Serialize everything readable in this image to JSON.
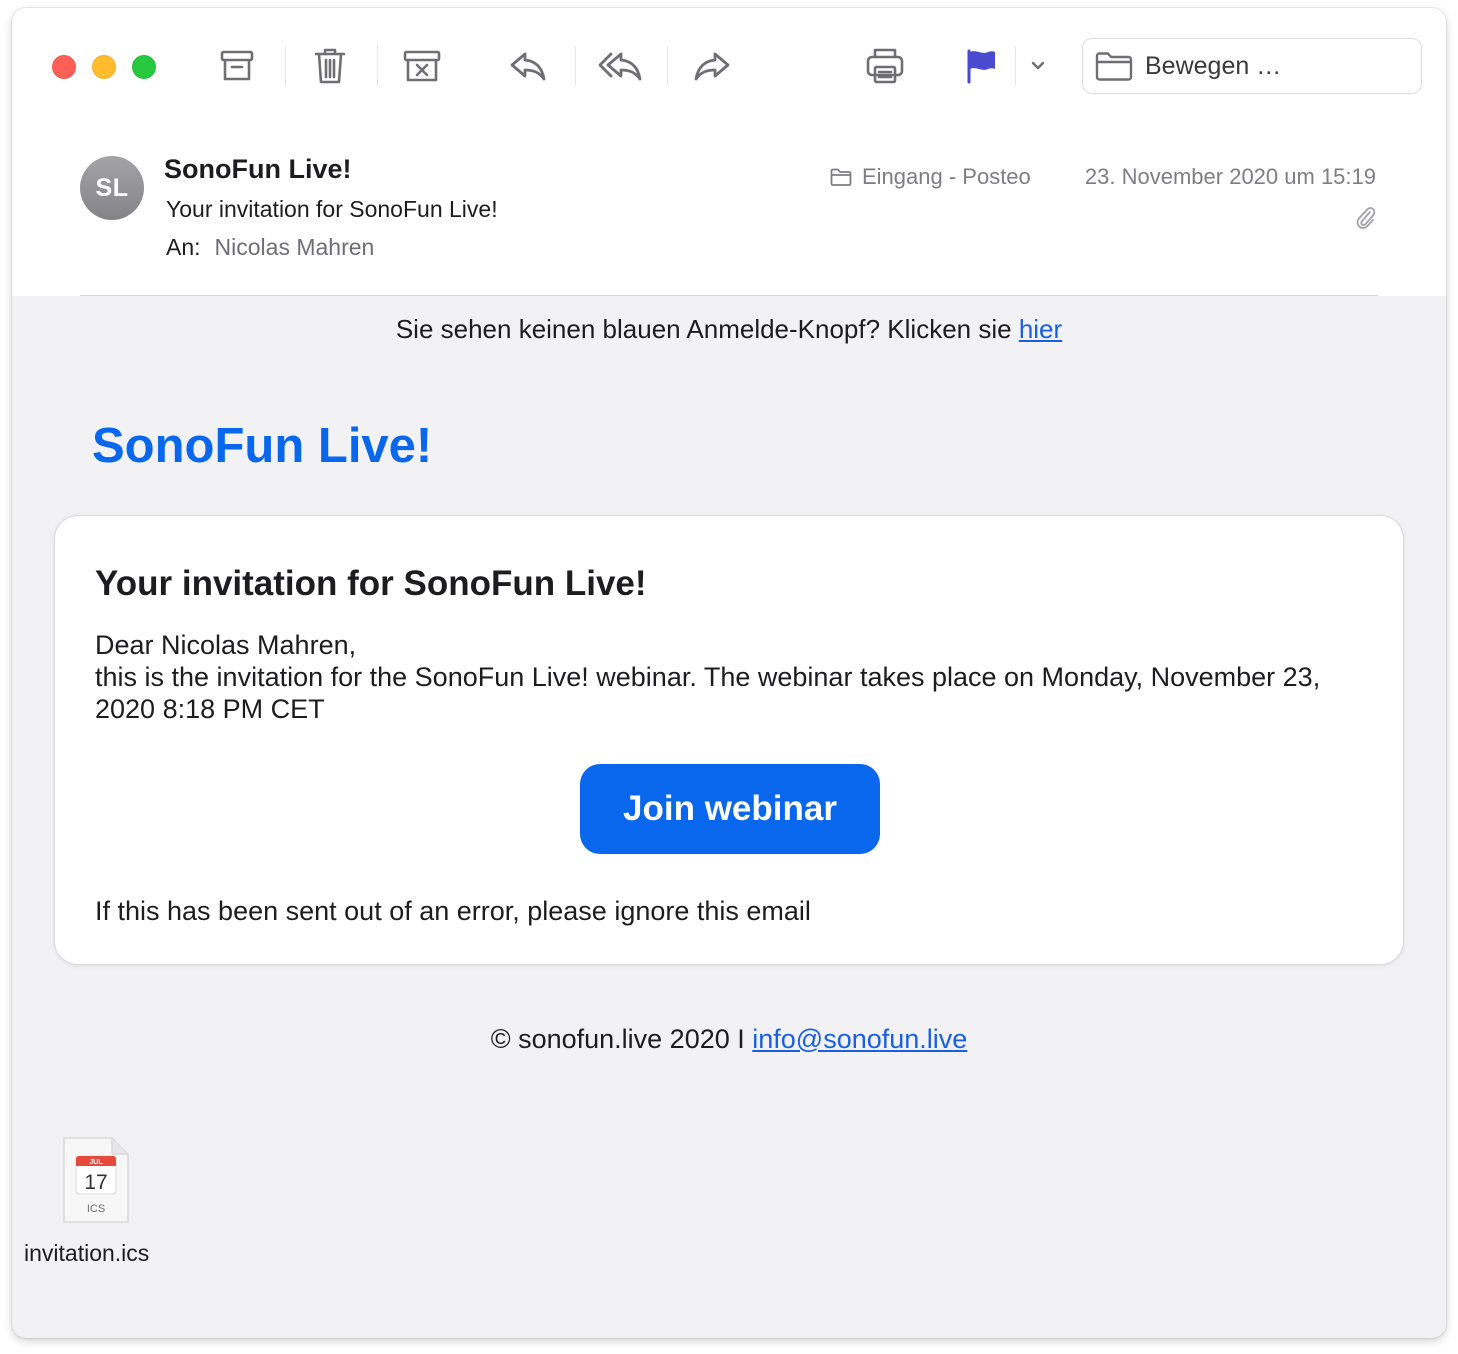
{
  "toolbar": {
    "move_label": "Bewegen …",
    "buttons": [
      "archive-icon",
      "trash-icon",
      "junk-icon",
      "reply-icon",
      "reply-all-icon",
      "forward-icon",
      "print-icon",
      "flag-icon",
      "chevron-down-icon",
      "folder-icon"
    ]
  },
  "colors": {
    "accent": "#0867ec",
    "flag": "#4a4ad0",
    "link": "#1a5fe0",
    "traffic_red": "#fe5f57",
    "traffic_yellow": "#febc2e",
    "traffic_green": "#28c840"
  },
  "header": {
    "avatar_initials": "SL",
    "sender": "SonoFun Live!",
    "subject": "Your invitation for SonoFun Live!",
    "to_label": "An:",
    "to_name": "Nicolas Mahren",
    "mailbox": "Eingang - Posteo",
    "date": "23. November 2020 um 15:19"
  },
  "body": {
    "notice_text": "Sie sehen keinen blauen Anmelde-Knopf? Klicken sie ",
    "notice_link": "hier",
    "brand": "SonoFun Live!",
    "card": {
      "title": "Your invitation for SonoFun Live!",
      "greeting": "Dear Nicolas Mahren,",
      "text": "this is the invitation for the SonoFun Live! webinar. The webinar takes place on Monday, November 23, 2020 8:18 PM CET",
      "button": "Join webinar",
      "ignore": "If this has been sent out of an error, please ignore this email"
    },
    "footer_text": "© sonofun.live 2020 I ",
    "footer_link": "info@sonofun.live"
  },
  "attachment": {
    "name": "invitation.ics",
    "icon_month": "JUL",
    "icon_day": "17",
    "icon_ext": "ICS"
  }
}
